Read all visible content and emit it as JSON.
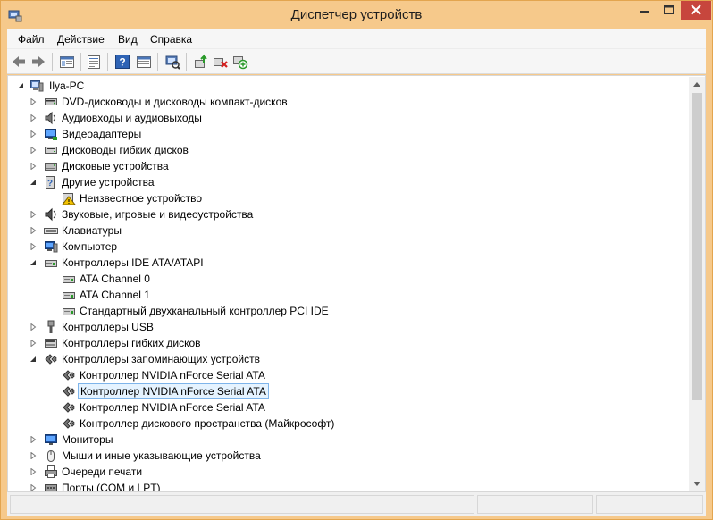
{
  "window": {
    "title": "Диспетчер устройств",
    "accent": "#f6c98b",
    "close_color": "#c7463d"
  },
  "menu": {
    "file": "Файл",
    "action": "Действие",
    "view": "Вид",
    "help": "Справка"
  },
  "toolbar": {
    "buttons": [
      "back-icon",
      "forward-icon",
      "show-hide-tree-icon",
      "properties-icon",
      "help-icon",
      "view-icon",
      "scan-hardware-icon",
      "update-driver-icon",
      "uninstall-icon",
      "add-device-icon"
    ]
  },
  "tree": {
    "root": "Ilya-PC",
    "rows": [
      {
        "label": "DVD-дисководы и дисководы компакт-дисков",
        "level": 1,
        "expander": "collapsed",
        "icon": "dvd-drive-icon"
      },
      {
        "label": "Аудиовходы и аудиовыходы",
        "level": 1,
        "expander": "collapsed",
        "icon": "audio-icon"
      },
      {
        "label": "Видеоадаптеры",
        "level": 1,
        "expander": "collapsed",
        "icon": "display-adapter-icon"
      },
      {
        "label": "Дисководы гибких дисков",
        "level": 1,
        "expander": "collapsed",
        "icon": "floppy-drive-icon"
      },
      {
        "label": "Дисковые устройства",
        "level": 1,
        "expander": "collapsed",
        "icon": "disk-drive-icon"
      },
      {
        "label": "Другие устройства",
        "level": 1,
        "expander": "expanded",
        "icon": "other-devices-icon"
      },
      {
        "label": "Неизвестное устройство",
        "level": 2,
        "expander": "none",
        "icon": "unknown-device-warning-icon"
      },
      {
        "label": "Звуковые, игровые и видеоустройства",
        "level": 1,
        "expander": "collapsed",
        "icon": "sound-icon"
      },
      {
        "label": "Клавиатуры",
        "level": 1,
        "expander": "collapsed",
        "icon": "keyboard-icon"
      },
      {
        "label": "Компьютер",
        "level": 1,
        "expander": "collapsed",
        "icon": "computer-icon"
      },
      {
        "label": "Контроллеры IDE ATA/ATAPI",
        "level": 1,
        "expander": "expanded",
        "icon": "ide-controller-icon"
      },
      {
        "label": "ATA Channel 0",
        "level": 2,
        "expander": "none",
        "icon": "ide-channel-icon"
      },
      {
        "label": "ATA Channel 1",
        "level": 2,
        "expander": "none",
        "icon": "ide-channel-icon"
      },
      {
        "label": "Стандартный двухканальный контроллер PCI IDE",
        "level": 2,
        "expander": "none",
        "icon": "ide-channel-icon"
      },
      {
        "label": "Контроллеры USB",
        "level": 1,
        "expander": "collapsed",
        "icon": "usb-icon"
      },
      {
        "label": "Контроллеры гибких дисков",
        "level": 1,
        "expander": "collapsed",
        "icon": "floppy-controller-icon"
      },
      {
        "label": "Контроллеры запоминающих устройств",
        "level": 1,
        "expander": "expanded",
        "icon": "storage-controller-icon"
      },
      {
        "label": "Контроллер NVIDIA nForce Serial ATA",
        "level": 2,
        "expander": "none",
        "icon": "storage-controller-icon"
      },
      {
        "label": "Контроллер NVIDIA nForce Serial ATA",
        "level": 2,
        "expander": "none",
        "icon": "storage-controller-icon",
        "selected": true
      },
      {
        "label": "Контроллер NVIDIA nForce Serial ATA",
        "level": 2,
        "expander": "none",
        "icon": "storage-controller-icon"
      },
      {
        "label": "Контроллер дискового пространства (Майкрософт)",
        "level": 2,
        "expander": "none",
        "icon": "storage-controller-icon"
      },
      {
        "label": "Мониторы",
        "level": 1,
        "expander": "collapsed",
        "icon": "monitor-icon"
      },
      {
        "label": "Мыши и иные указывающие устройства",
        "level": 1,
        "expander": "collapsed",
        "icon": "mouse-icon"
      },
      {
        "label": "Очереди печати",
        "level": 1,
        "expander": "collapsed",
        "icon": "printer-icon"
      },
      {
        "label": "Порты (COM и LPT)",
        "level": 1,
        "expander": "collapsed",
        "icon": "port-icon"
      }
    ]
  }
}
